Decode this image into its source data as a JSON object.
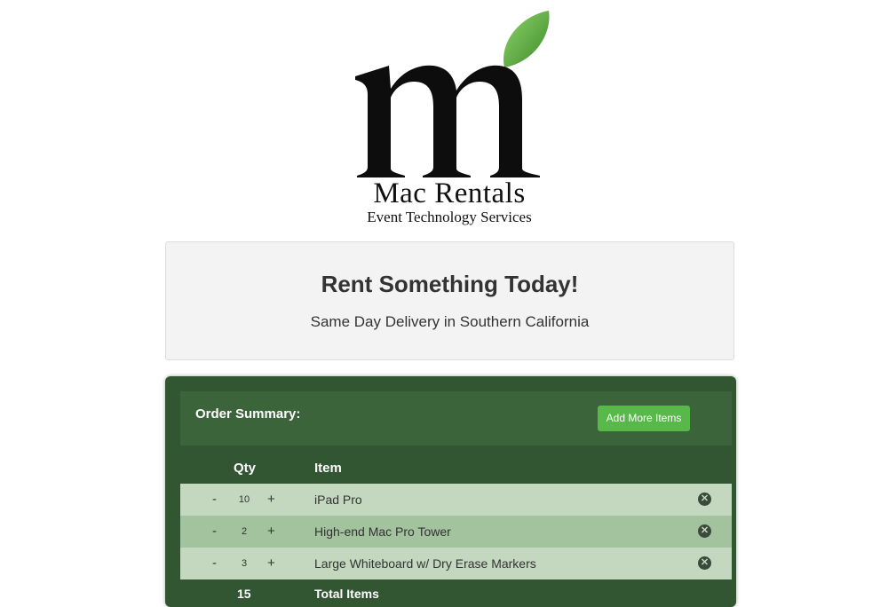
{
  "logo": {
    "title": "Mac Rentals",
    "subtitle": "Event Technology Services",
    "icon": "m-leaf-logo"
  },
  "hero": {
    "title": "Rent Something Today!",
    "subtitle": "Same Day Delivery in Southern California"
  },
  "order": {
    "title": "Order Summary:",
    "add_button": "Add More Items",
    "columns": {
      "qty": "Qty",
      "item": "Item"
    },
    "rows": [
      {
        "minus": "-",
        "qty": "10",
        "plus": "+",
        "item": "iPad Pro",
        "remove_icon": "remove-icon"
      },
      {
        "minus": "-",
        "qty": "2",
        "plus": "+",
        "item": "High-end Mac Pro Tower",
        "remove_icon": "remove-icon"
      },
      {
        "minus": "-",
        "qty": "3",
        "plus": "+",
        "item": "Large Whiteboard w/ Dry Erase Markers",
        "remove_icon": "remove-icon"
      }
    ],
    "total": {
      "qty": "15",
      "label": "Total Items"
    }
  },
  "colors": {
    "panel_bg": "#325532",
    "panel_header": "#3b643b",
    "button": "#58b94a",
    "row_light": "#c4d8c0",
    "row_mid": "#a3c29e",
    "leaf": "#5aa83c"
  }
}
